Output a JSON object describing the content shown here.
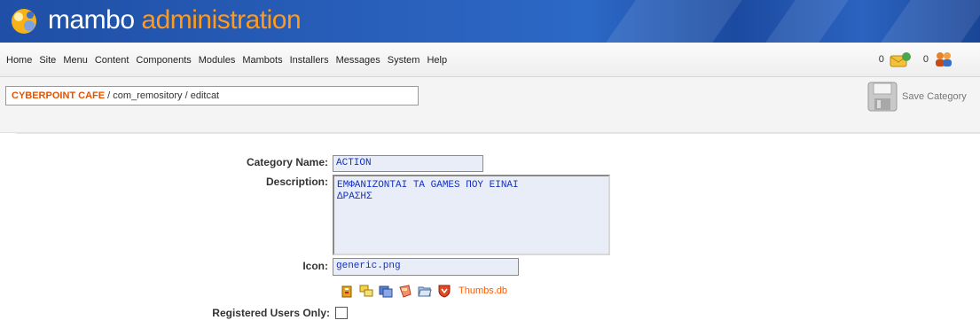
{
  "header": {
    "brand_word1": "mambo",
    "brand_word2": "administration",
    "brand_color_white": "#ffffff",
    "brand_color_orange": "#ff9a1a",
    "logo_icon": "mambo-logo-icon"
  },
  "menu": {
    "items": [
      "Home",
      "Site",
      "Menu",
      "Content",
      "Components",
      "Modules",
      "Mambots",
      "Installers",
      "Messages",
      "System",
      "Help"
    ]
  },
  "stats": {
    "messages_count": "0",
    "messages_icon": "envelope-icon",
    "users_count": "0",
    "users_icon": "users-icon"
  },
  "pathway": {
    "site": "CYBERPOINT CAFE",
    "rest": " / com_remository / editcat"
  },
  "toolbar": {
    "save_label": "Save Category",
    "save_icon": "floppy-disk-icon"
  },
  "form": {
    "category_name_label": "Category Name:",
    "category_name_value": "ACTION",
    "description_label": "Description:",
    "description_value": "ΕΜΦΑΝΙΖΟΝΤΑΙ ΤΑ GAMES ΠΟΥ ΕΙΝΑΙ\nΔΡΑΣΗΣ",
    "icon_label": "Icon:",
    "icon_value": "generic.png",
    "icon_choices": [
      "archive-icon",
      "folders-icon",
      "images-icon",
      "shield-bookmark-icon",
      "folder-open-icon",
      "heart-shield-icon"
    ],
    "thumbs_link": "Thumbs.db",
    "registered_label": "Registered Users Only:",
    "registered_checked": false
  }
}
